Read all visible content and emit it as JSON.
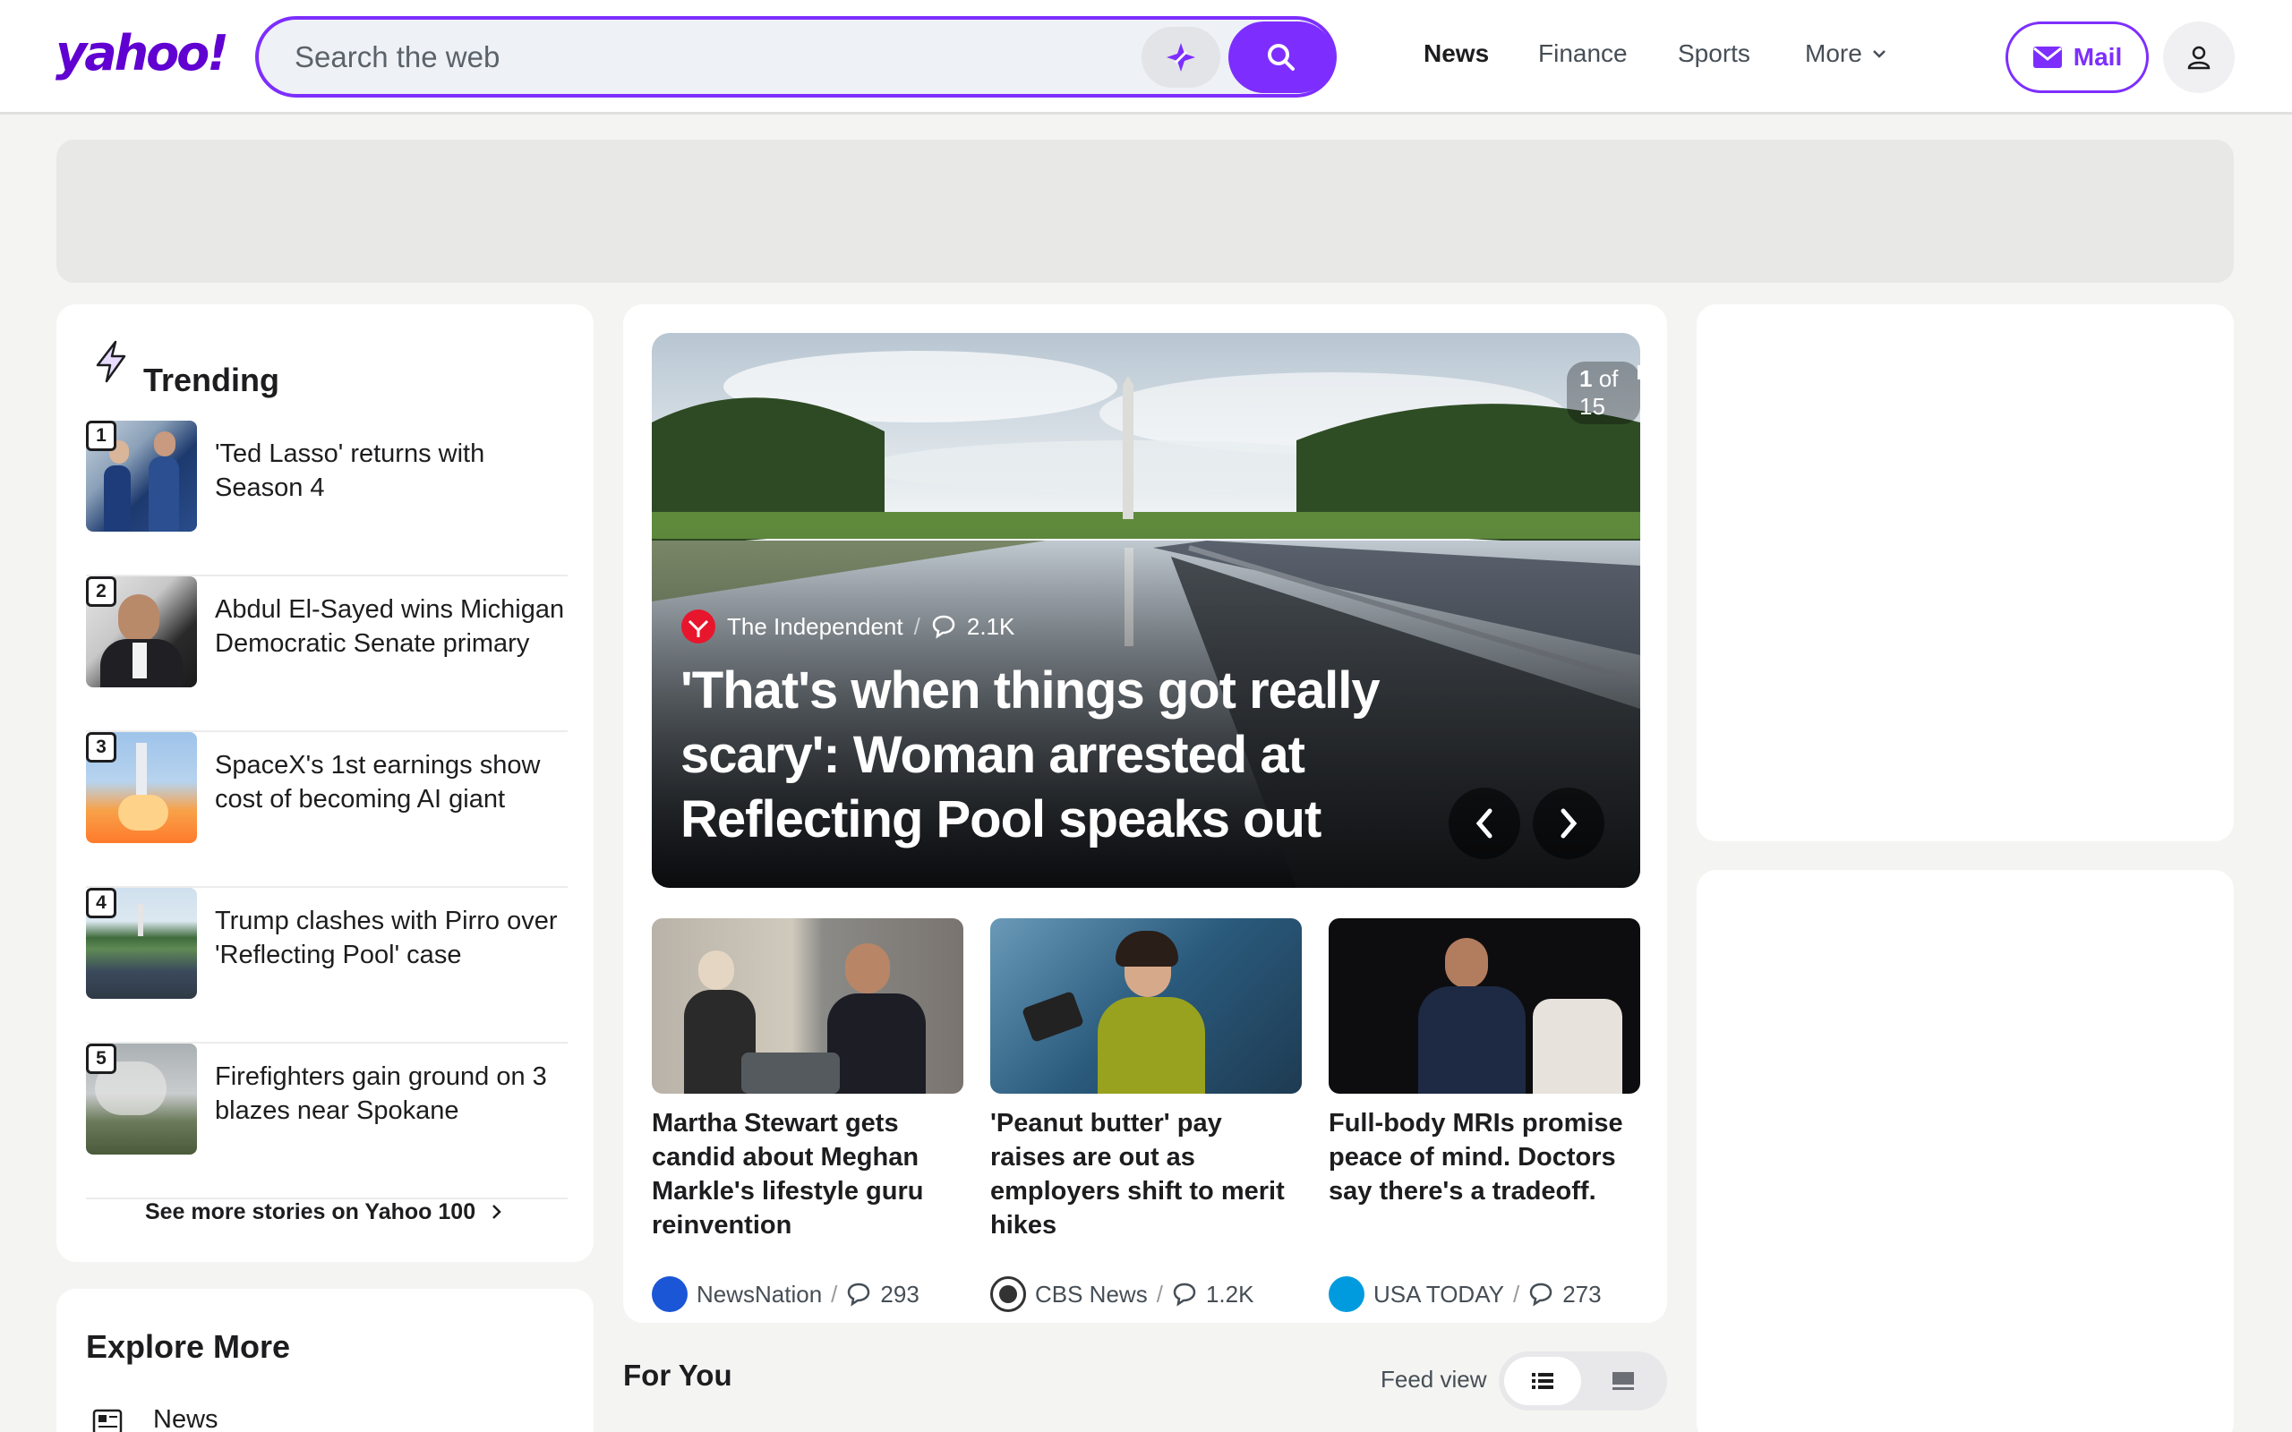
{
  "header": {
    "logo": "yahoo!",
    "search_placeholder": "Search the web",
    "nav": [
      "News",
      "Finance",
      "Sports",
      "More"
    ],
    "mail_label": "Mail"
  },
  "colors": {
    "brand": "#6001d2",
    "accent": "#7d2eff"
  },
  "trending": {
    "title": "Trending",
    "items": [
      {
        "rank": "1",
        "text": "'Ted Lasso' returns with Season 4"
      },
      {
        "rank": "2",
        "text": "Abdul El-Sayed wins Michigan Democratic Senate primary"
      },
      {
        "rank": "3",
        "text": "SpaceX's 1st earnings show cost of becoming AI giant"
      },
      {
        "rank": "4",
        "text": "Trump clashes with Pirro over 'Reflecting Pool' case"
      },
      {
        "rank": "5",
        "text": "Firefighters gain ground on 3 blazes near Spokane"
      }
    ],
    "see_more": "See more stories on Yahoo 100"
  },
  "explore": {
    "title": "Explore More",
    "first_item": "News"
  },
  "hero": {
    "counter_current": "1",
    "counter_text": " of 15",
    "source": "The Independent",
    "comments": "2.1K",
    "title": "'That's when things got really scary': Woman arrested at Reflecting Pool speaks out"
  },
  "stories": [
    {
      "title": "Martha Stewart gets candid about Meghan Markle's lifestyle guru reinvention",
      "source": "NewsNation",
      "comments": "293"
    },
    {
      "title": "'Peanut butter' pay raises are out as employers shift to merit hikes",
      "source": "CBS News",
      "comments": "1.2K"
    },
    {
      "title": "Full-body MRIs promise peace of mind. Doctors say there's a tradeoff.",
      "source": "USA TODAY",
      "comments": "273"
    }
  ],
  "for_you": {
    "title": "For You",
    "feed_view_label": "Feed view"
  }
}
